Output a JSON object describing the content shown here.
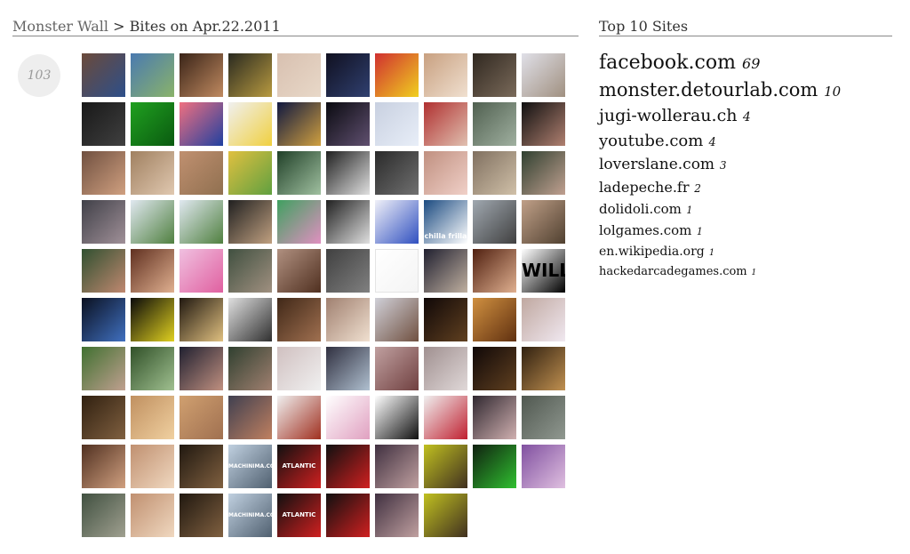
{
  "breadcrumb": {
    "root": "Monster Wall",
    "separator": ">",
    "current": "Bites on Apr.22.2011"
  },
  "bite_count": "103",
  "sidebar": {
    "title": "Top 10 Sites",
    "sites": [
      {
        "name": "facebook.com",
        "count": "69"
      },
      {
        "name": "monster.detourlab.com",
        "count": "10"
      },
      {
        "name": "jugi-wollerau.ch",
        "count": "4"
      },
      {
        "name": "youtube.com",
        "count": "4"
      },
      {
        "name": "loverslane.com",
        "count": "3"
      },
      {
        "name": "ladepeche.fr",
        "count": "2"
      },
      {
        "name": "dolidoli.com",
        "count": "1"
      },
      {
        "name": "lolgames.com",
        "count": "1"
      },
      {
        "name": "en.wikipedia.org",
        "count": "1"
      },
      {
        "name": "hackedarcadegames.com",
        "count": "1"
      }
    ]
  },
  "thumbnails": [
    {
      "c1": "#6b4a3a",
      "c2": "#2d4f8a"
    },
    {
      "c1": "#4a7ab0",
      "c2": "#8ab36a"
    },
    {
      "c1": "#3a2418",
      "c2": "#c08a60"
    },
    {
      "c1": "#2a2a20",
      "c2": "#b89a40"
    },
    {
      "c1": "#d8c0b0",
      "c2": "#e8d8c8"
    },
    {
      "c1": "#101020",
      "c2": "#304070"
    },
    {
      "c1": "#d03030",
      "c2": "#f0d020"
    },
    {
      "c1": "#c8a080",
      "c2": "#f0e0d0"
    },
    {
      "c1": "#302820",
      "c2": "#7a6a5a"
    },
    {
      "c1": "#e0e0e8",
      "c2": "#a09080"
    },
    {
      "c1": "#181818",
      "c2": "#404040"
    },
    {
      "c1": "#20a020",
      "c2": "#0a5a10"
    },
    {
      "c1": "#f07080",
      "c2": "#2040a0"
    },
    {
      "c1": "#f0f0f0",
      "c2": "#f0d040"
    },
    {
      "c1": "#101840",
      "c2": "#d0a040"
    },
    {
      "c1": "#0a0a10",
      "c2": "#605070"
    },
    {
      "c1": "#c8d0e0",
      "c2": "#e8eef8"
    },
    {
      "c1": "#b03030",
      "c2": "#e0c0b0"
    },
    {
      "c1": "#506050",
      "c2": "#a0b0a0"
    },
    {
      "c1": "#101010",
      "c2": "#b08070"
    },
    {
      "c1": "#705040",
      "c2": "#d0a080"
    },
    {
      "c1": "#a08060",
      "c2": "#e0c8b0"
    },
    {
      "c1": "#c09070",
      "c2": "#907050"
    },
    {
      "c1": "#e0c040",
      "c2": "#60a040"
    },
    {
      "c1": "#204028",
      "c2": "#a0c0a0"
    },
    {
      "c1": "#202020",
      "c2": "#e0e0e0"
    },
    {
      "c1": "#2a2a2a",
      "c2": "#707070"
    },
    {
      "c1": "#c09080",
      "c2": "#f0d0c8"
    },
    {
      "c1": "#807060",
      "c2": "#d0c0a8"
    },
    {
      "c1": "#304030",
      "c2": "#c0a090"
    },
    {
      "c1": "#404048",
      "c2": "#a09098"
    },
    {
      "c1": "#e0e8f0",
      "c2": "#508040"
    },
    {
      "c1": "#e0e8f0",
      "c2": "#508040"
    },
    {
      "c1": "#202020",
      "c2": "#c0a080"
    },
    {
      "c1": "#40a060",
      "c2": "#e090c0"
    },
    {
      "c1": "#202020",
      "c2": "#e0e0e0"
    },
    {
      "c1": "#f0f0f8",
      "c2": "#3050c0"
    },
    {
      "c1": "#1a4a80",
      "c2": "#ffffff"
    },
    {
      "c1": "#a0a8b0",
      "c2": "#404040"
    },
    {
      "c1": "#c0a088",
      "c2": "#504030"
    },
    {
      "c1": "#305030",
      "c2": "#c08870"
    },
    {
      "c1": "#603020",
      "c2": "#e0b090"
    },
    {
      "c1": "#f0c0e0",
      "c2": "#e060a0"
    },
    {
      "c1": "#405040",
      "c2": "#a09080"
    },
    {
      "c1": "#b09080",
      "c2": "#503020"
    },
    {
      "c1": "#404040",
      "c2": "#808080"
    },
    {
      "c1": "#ffffff",
      "c2": "#f4f4f4"
    },
    {
      "c1": "#202030",
      "c2": "#c0b0a0"
    },
    {
      "c1": "#502010",
      "c2": "#e0b090"
    },
    {
      "c1": "#ffffff",
      "c2": "#000000"
    },
    {
      "c1": "#0a1020",
      "c2": "#4070c0"
    },
    {
      "c1": "#0a0a0a",
      "c2": "#e0d020"
    },
    {
      "c1": "#201810",
      "c2": "#e0c080"
    },
    {
      "c1": "#e0e0e0",
      "c2": "#303030"
    },
    {
      "c1": "#402818",
      "c2": "#a07050"
    },
    {
      "c1": "#a08070",
      "c2": "#f0e0d0"
    },
    {
      "c1": "#d0d0d8",
      "c2": "#705040"
    },
    {
      "c1": "#100808",
      "c2": "#604020"
    },
    {
      "c1": "#d09040",
      "c2": "#603010"
    },
    {
      "c1": "#c0a8a0",
      "c2": "#f0e8f0"
    },
    {
      "c1": "#407030",
      "c2": "#c0a090"
    },
    {
      "c1": "#305028",
      "c2": "#a0c090"
    },
    {
      "c1": "#202030",
      "c2": "#c09080"
    },
    {
      "c1": "#304030",
      "c2": "#a08070"
    },
    {
      "c1": "#d0c0c0",
      "c2": "#f0f0f0"
    },
    {
      "c1": "#303040",
      "c2": "#b0c0d0"
    },
    {
      "c1": "#c0a0a0",
      "c2": "#704040"
    },
    {
      "c1": "#a09090",
      "c2": "#e0d8d8"
    },
    {
      "c1": "#100808",
      "c2": "#604020"
    },
    {
      "c1": "#302010",
      "c2": "#c09050"
    },
    {
      "c1": "#302010",
      "c2": "#806040"
    },
    {
      "c1": "#c09060",
      "c2": "#f0d0a0"
    },
    {
      "c1": "#d0a070",
      "c2": "#a07050"
    },
    {
      "c1": "#404050",
      "c2": "#c08060"
    },
    {
      "c1": "#f0f0f0",
      "c2": "#a03020"
    },
    {
      "c1": "#ffffff",
      "c2": "#e0a0c0"
    },
    {
      "c1": "#ffffff",
      "c2": "#101010"
    },
    {
      "c1": "#f0f0f0",
      "c2": "#c02030"
    },
    {
      "c1": "#302830",
      "c2": "#d0b0b0"
    },
    {
      "c1": "#505850",
      "c2": "#909890"
    },
    {
      "c1": "#503020",
      "c2": "#d0a080"
    },
    {
      "c1": "#c09070",
      "c2": "#f0d8c0"
    },
    {
      "c1": "#201810",
      "c2": "#806040"
    },
    {
      "c1": "#c0d0e0",
      "c2": "#506070"
    },
    {
      "c1": "#101010",
      "c2": "#d02020"
    },
    {
      "c1": "#101010",
      "c2": "#d02020"
    },
    {
      "c1": "#403040",
      "c2": "#c0a0a0"
    },
    {
      "c1": "#c0c020",
      "c2": "#403020"
    },
    {
      "c1": "#102010",
      "c2": "#30c030"
    },
    {
      "c1": "#8050a0",
      "c2": "#e0c0e0"
    },
    {
      "c1": "#405040",
      "c2": "#a0a090"
    },
    {
      "c1": "#c09070",
      "c2": "#f0d8c0"
    },
    {
      "c1": "#201810",
      "c2": "#806040"
    },
    {
      "c1": "#c0d0e0",
      "c2": "#506070"
    },
    {
      "c1": "#101010",
      "c2": "#d02020"
    },
    {
      "c1": "#101010",
      "c2": "#d02020"
    },
    {
      "c1": "#403040",
      "c2": "#c0a0a0"
    },
    {
      "c1": "#c0c020",
      "c2": "#403020"
    }
  ],
  "thumb_labels": {
    "will": "WILL",
    "chilla": "chilla frilla",
    "atlantic": "ATLANTIC",
    "machinima": "MACHINIMA.COM"
  }
}
